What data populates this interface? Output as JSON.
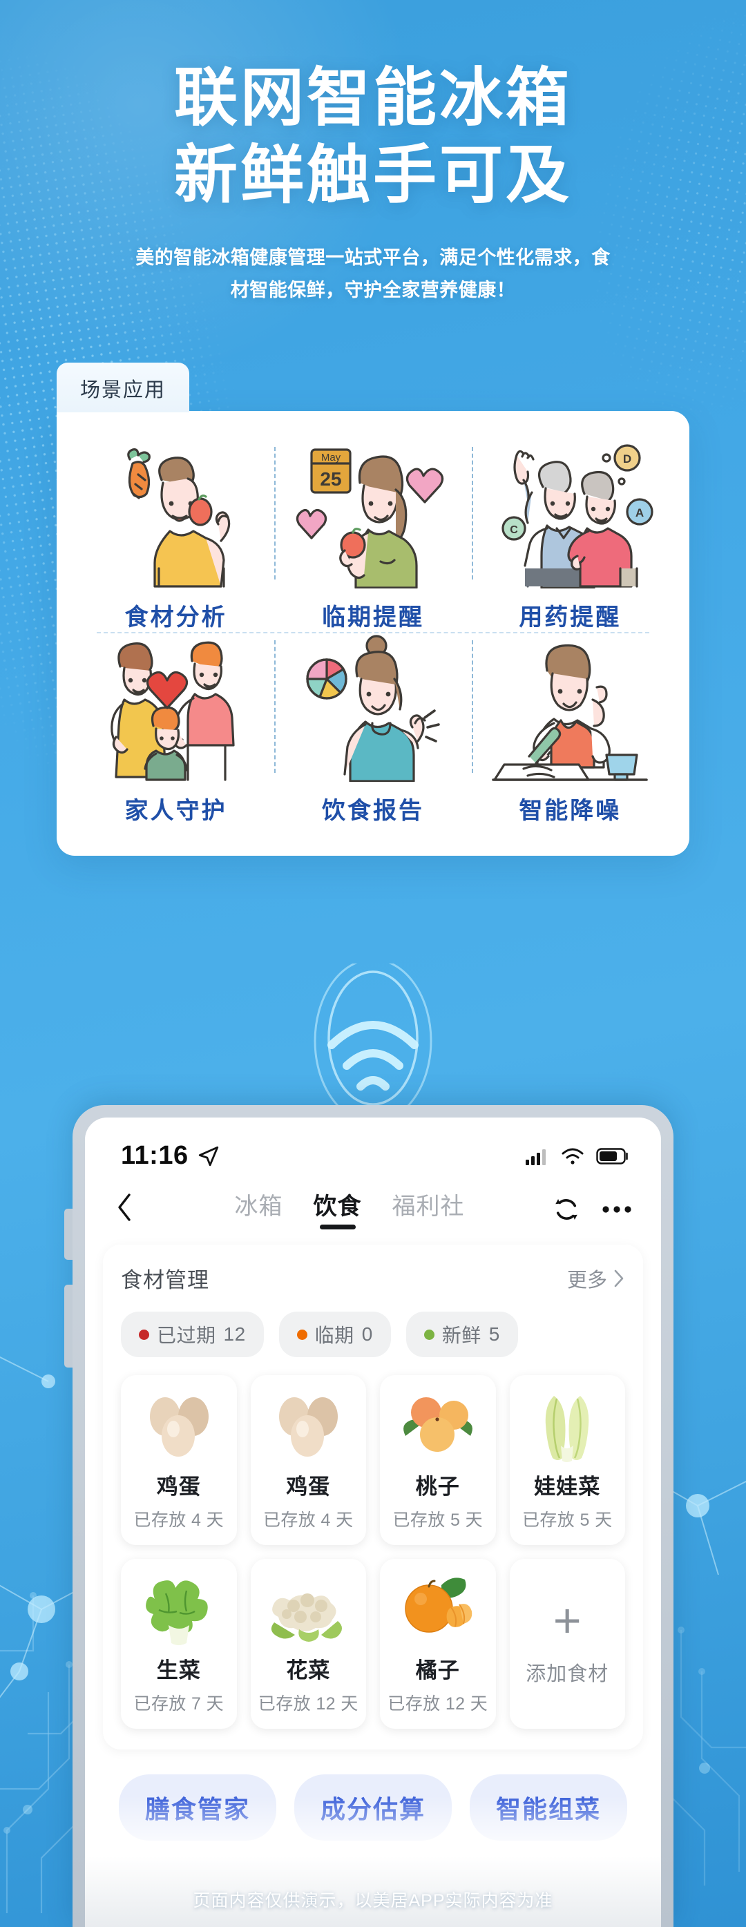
{
  "hero": {
    "title_line1": "联网智能冰箱",
    "title_line2": "新鲜触手可及",
    "subtitle_line1": "美的智能冰箱健康管理一站式平台，满足个性化需求，食",
    "subtitle_line2": "材智能保鲜，守护全家营养健康！"
  },
  "scenario_panel": {
    "tab_label": "场景应用",
    "features": [
      {
        "label": "食材分析",
        "icon": "person-with-vegetables-icon"
      },
      {
        "label": "临期提醒",
        "icon": "calendar-woman-apple-icon"
      },
      {
        "label": "用药提醒",
        "icon": "elderly-couple-vitamins-icon"
      },
      {
        "label": "家人守护",
        "icon": "family-heart-icon"
      },
      {
        "label": "饮食报告",
        "icon": "woman-pie-chart-icon"
      },
      {
        "label": "智能降噪",
        "icon": "woman-writing-desk-icon"
      }
    ]
  },
  "wifi_badge": {
    "icon": "wifi-signal-icon"
  },
  "phone": {
    "statusbar": {
      "time": "11:16",
      "location_icon": "location-arrow-icon",
      "signal_icon": "cellular-signal-icon",
      "wifi_icon": "wifi-icon",
      "battery_icon": "battery-icon"
    },
    "navbar": {
      "back_icon": "chevron-left-icon",
      "tabs": [
        {
          "label": "冰箱",
          "active": false
        },
        {
          "label": "饮食",
          "active": true
        },
        {
          "label": "福利社",
          "active": false
        }
      ],
      "refresh_icon": "refresh-icon",
      "more_icon": "more-dots-icon"
    },
    "food_card": {
      "title": "食材管理",
      "more_label": "更多",
      "more_icon": "chevron-right-icon",
      "chips": [
        {
          "label": "已过期",
          "count": "12",
          "color": "#c62828"
        },
        {
          "label": "临期",
          "count": "0",
          "color": "#ef6c00"
        },
        {
          "label": "新鲜",
          "count": "5",
          "color": "#7cb342"
        }
      ],
      "items": [
        {
          "name": "鸡蛋",
          "days": "已存放 4 天",
          "icon": "eggs-icon"
        },
        {
          "name": "鸡蛋",
          "days": "已存放 4 天",
          "icon": "eggs-icon"
        },
        {
          "name": "桃子",
          "days": "已存放 5 天",
          "icon": "peaches-icon"
        },
        {
          "name": "娃娃菜",
          "days": "已存放 5 天",
          "icon": "baby-cabbage-icon"
        },
        {
          "name": "生菜",
          "days": "已存放 7 天",
          "icon": "lettuce-icon"
        },
        {
          "name": "花菜",
          "days": "已存放 12 天",
          "icon": "cauliflower-icon"
        },
        {
          "name": "橘子",
          "days": "已存放 12 天",
          "icon": "orange-icon"
        }
      ],
      "add_tile": {
        "plus": "+",
        "label": "添加食材",
        "icon": "plus-icon"
      }
    },
    "actions": [
      {
        "label": "膳食管家"
      },
      {
        "label": "成分估算"
      },
      {
        "label": "智能组菜"
      }
    ]
  },
  "footer": {
    "note": "页面内容仅供演示，以美居APP实际内容为准"
  },
  "colors": {
    "bg_blue": "#3fa3e0",
    "feature_label": "#1f4fa8",
    "action_text": "#3a5fd9",
    "action_bg": "#e9eefc"
  }
}
